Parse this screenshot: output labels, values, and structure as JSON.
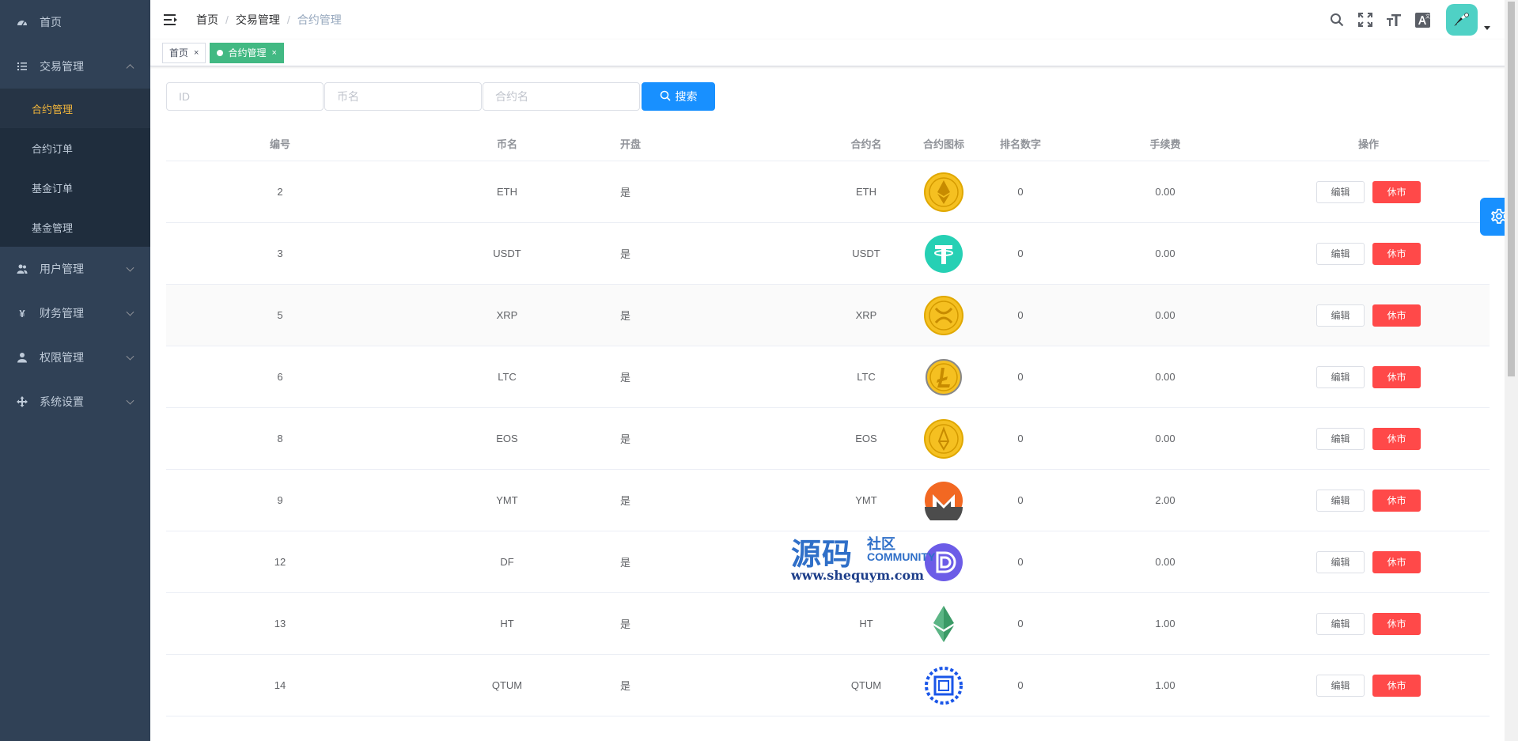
{
  "sidebar": {
    "items": [
      {
        "label": "首页",
        "icon": "dashboard-icon"
      },
      {
        "label": "交易管理",
        "icon": "list-icon",
        "expanded": true,
        "children": [
          {
            "label": "合约管理",
            "active": true
          },
          {
            "label": "合约订单"
          },
          {
            "label": "基金订单"
          },
          {
            "label": "基金管理"
          }
        ]
      },
      {
        "label": "用户管理",
        "icon": "users-icon"
      },
      {
        "label": "财务管理",
        "icon": "yen-icon"
      },
      {
        "label": "权限管理",
        "icon": "user-icon"
      },
      {
        "label": "系统设置",
        "icon": "move-icon"
      }
    ]
  },
  "breadcrumb": [
    "首页",
    "交易管理",
    "合约管理"
  ],
  "tags": [
    {
      "label": "首页",
      "close": "×"
    },
    {
      "label": "合约管理",
      "close": "×",
      "active": true
    }
  ],
  "filters": {
    "id_placeholder": "ID",
    "coin_placeholder": "币名",
    "contract_placeholder": "合约名",
    "search_label": "搜索"
  },
  "table": {
    "headers": [
      "编号",
      "币名",
      "开盘",
      "合约名",
      "合约图标",
      "排名数字",
      "手续费",
      "操作"
    ],
    "rows": [
      {
        "id": "2",
        "coin": "ETH",
        "open": "是",
        "contract": "ETH",
        "rank": "0",
        "fee": "0.00",
        "icon": "eth-coin-icon",
        "color": "#f5c021"
      },
      {
        "id": "3",
        "coin": "USDT",
        "open": "是",
        "contract": "USDT",
        "rank": "0",
        "fee": "0.00",
        "icon": "usdt-coin-icon",
        "color": "#26d0b4"
      },
      {
        "id": "5",
        "coin": "XRP",
        "open": "是",
        "contract": "XRP",
        "rank": "0",
        "fee": "0.00",
        "icon": "xrp-coin-icon",
        "color": "#f5c021"
      },
      {
        "id": "6",
        "coin": "LTC",
        "open": "是",
        "contract": "LTC",
        "rank": "0",
        "fee": "0.00",
        "icon": "ltc-coin-icon",
        "color": "#f5c021"
      },
      {
        "id": "8",
        "coin": "EOS",
        "open": "是",
        "contract": "EOS",
        "rank": "0",
        "fee": "0.00",
        "icon": "eos-coin-icon",
        "color": "#f5c021"
      },
      {
        "id": "9",
        "coin": "YMT",
        "open": "是",
        "contract": "YMT",
        "rank": "0",
        "fee": "2.00",
        "icon": "monero-coin-icon",
        "color": "#f26822"
      },
      {
        "id": "12",
        "coin": "DF",
        "open": "是",
        "contract": "",
        "rank": "0",
        "fee": "0.00",
        "icon": "df-coin-icon",
        "color": "#6c5ce7"
      },
      {
        "id": "13",
        "coin": "HT",
        "open": "是",
        "contract": "HT",
        "rank": "0",
        "fee": "1.00",
        "icon": "ht-coin-icon",
        "color": "#3b9a66"
      },
      {
        "id": "14",
        "coin": "QTUM",
        "open": "是",
        "contract": "QTUM",
        "rank": "0",
        "fee": "1.00",
        "icon": "qtum-coin-icon",
        "color": "#1a56e8"
      }
    ],
    "edit_label": "编辑",
    "halt_label": "休市"
  },
  "watermark": {
    "big": "源码",
    "small": "社区",
    "community": "COMMUNITY",
    "url": "www.shequym.com"
  }
}
